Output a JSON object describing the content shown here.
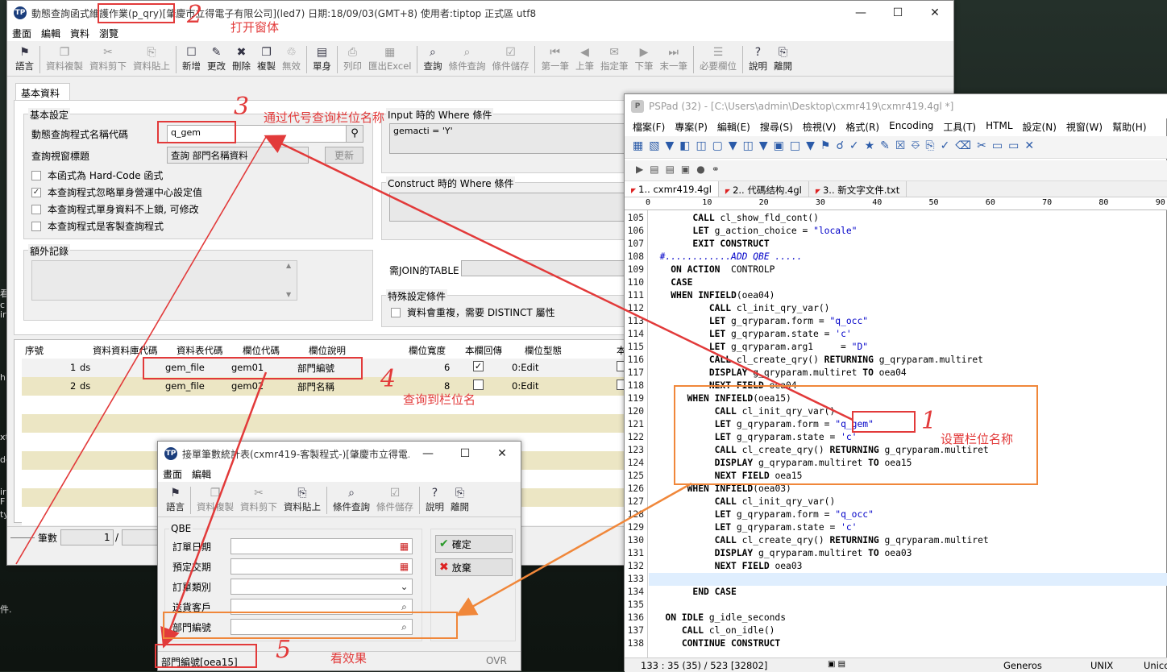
{
  "desktop_fragments": [
    "看",
    "c",
    "ir",
    "h",
    "xt",
    "dc",
    "ir",
    "F",
    "ty",
    "件."
  ],
  "main_window": {
    "title": "動態查詢函式維護作業(p_qry)[肇慶市立得電子有限公司](led7)  日期:18/09/03(GMT+8)  使用者:tiptop 正式區 utf8",
    "menu": [
      "畫面",
      "編輯",
      "資料",
      "瀏覽"
    ],
    "toolbar": [
      {
        "label": "語言",
        "icon": "flag-icon",
        "enabled": true
      },
      {
        "label": "資料複製",
        "icon": "copy-icon",
        "enabled": false
      },
      {
        "label": "資料剪下",
        "icon": "scissors-icon",
        "enabled": false
      },
      {
        "label": "資料貼上",
        "icon": "paste-icon",
        "enabled": false
      },
      {
        "label": "新增",
        "icon": "new-doc-icon",
        "enabled": true
      },
      {
        "label": "更改",
        "icon": "pencil-icon",
        "enabled": true
      },
      {
        "label": "刪除",
        "icon": "delete-icon",
        "enabled": true
      },
      {
        "label": "複製",
        "icon": "duplicate-icon",
        "enabled": true
      },
      {
        "label": "無效",
        "icon": "trash-icon",
        "enabled": false
      },
      {
        "label": "單身",
        "icon": "detail-icon",
        "enabled": true
      },
      {
        "label": "列印",
        "icon": "printer-icon",
        "enabled": false
      },
      {
        "label": "匯出Excel",
        "icon": "excel-icon",
        "enabled": false
      },
      {
        "label": "查詢",
        "icon": "query-icon",
        "enabled": true
      },
      {
        "label": "條件查詢",
        "icon": "condition-query-icon",
        "enabled": false
      },
      {
        "label": "條件儲存",
        "icon": "condition-save-icon",
        "enabled": false
      },
      {
        "label": "第一筆",
        "icon": "first-record-icon",
        "enabled": false
      },
      {
        "label": "上筆",
        "icon": "prev-record-icon",
        "enabled": false
      },
      {
        "label": "指定筆",
        "icon": "goto-record-icon",
        "enabled": false
      },
      {
        "label": "下筆",
        "icon": "next-record-icon",
        "enabled": false
      },
      {
        "label": "末一筆",
        "icon": "last-record-icon",
        "enabled": false
      },
      {
        "label": "必要欄位",
        "icon": "required-fields-icon",
        "enabled": false
      },
      {
        "label": "說明",
        "icon": "help-icon",
        "enabled": true
      },
      {
        "label": "離開",
        "icon": "exit-icon",
        "enabled": true
      }
    ],
    "tab": "基本資料",
    "basic_group": "基本設定",
    "func_code_label": "動態查詢程式名稱代碼",
    "func_code_value": "q_gem",
    "title_label": "查詢視窗標題",
    "title_value": "查詢 部門名稱資料",
    "update_button": "更新",
    "checkboxes": [
      {
        "label": "本函式為 Hard-Code 函式",
        "checked": false
      },
      {
        "label": "本查詢程式忽略單身營運中心設定值",
        "checked": true
      },
      {
        "label": "本查詢程式單身資料不上鎖, 可修改",
        "checked": false
      },
      {
        "label": "本查詢程式是客製查詢程式",
        "checked": false
      }
    ],
    "extra_group": "額外記錄",
    "input_where_label": "Input 時的 Where 條件",
    "input_where_value": "gemacti = 'Y'",
    "construct_where_label": "Construct 時的 Where 條件",
    "join_label": "需JOIN的TABLE",
    "special_group": "特殊設定條件",
    "distinct_label": "資料會重複，需要 DISTINCT 屬性",
    "grid_headers": [
      "序號",
      "資料資料庫代碼",
      "資料表代碼",
      "欄位代碼",
      "欄位說明",
      "欄位寬度",
      "本欄回傳",
      "欄位型態",
      "本欄"
    ],
    "grid_rows": [
      {
        "seq": "1",
        "db": "ds",
        "table": "gem_file",
        "field": "gem01",
        "desc": "部門編號",
        "width": "6",
        "ret": true,
        "type": "0:Edit"
      },
      {
        "seq": "2",
        "db": "ds",
        "table": "gem_file",
        "field": "gem02",
        "desc": "部門名稱",
        "width": "8",
        "ret": false,
        "type": "0:Edit"
      }
    ],
    "status_count_label": "筆數",
    "status_count": "1",
    "status_slash": "/"
  },
  "pspad": {
    "title": "PSPad (32) - [C:\\Users\\admin\\Desktop\\cxmr419\\cxmr419.4gl *]",
    "menu": [
      "檔案(F)",
      "專案(P)",
      "編輯(E)",
      "搜尋(S)",
      "檢視(V)",
      "格式(R)",
      "Encoding",
      "工具(T)",
      "HTML",
      "設定(N)",
      "視窗(W)",
      "幫助(H)"
    ],
    "tabs": [
      "1.. cxmr419.4gl",
      "2.. 代碼结构.4gl",
      "3.. 新文字文件.txt"
    ],
    "ruler": [
      "0",
      "10",
      "20",
      "30",
      "40",
      "50",
      "60",
      "70",
      "80",
      "90"
    ],
    "lines": [
      {
        "n": "105",
        "html": "        <span class='kw'>CALL</span> cl_show_fld_cont()"
      },
      {
        "n": "106",
        "html": "        <span class='kw'>LET</span> g_action_choice = <span class='str'>\"locale\"</span>"
      },
      {
        "n": "107",
        "html": "        <span class='kw'>EXIT CONSTRUCT</span>"
      },
      {
        "n": "108",
        "html": "  <span class='cmt'>#............ADD QBE .....</span>"
      },
      {
        "n": "109",
        "html": "    <span class='kw'>ON ACTION</span>  CONTROLP"
      },
      {
        "n": "110",
        "html": "    <span class='kw'>CASE</span>"
      },
      {
        "n": "111",
        "html": "    <span class='kw'>WHEN INFIELD</span>(oea04)"
      },
      {
        "n": "112",
        "html": "           <span class='kw'>CALL</span> cl_init_qry_var()"
      },
      {
        "n": "113",
        "html": "           <span class='kw'>LET</span> g_qryparam.form = <span class='str'>\"q_occ\"</span>"
      },
      {
        "n": "114",
        "html": "           <span class='kw'>LET</span> g_qryparam.state = <span class='str'>'c'</span>"
      },
      {
        "n": "115",
        "html": "           <span class='kw'>LET</span> g_qryparam.arg1     = <span class='str'>\"D\"</span>"
      },
      {
        "n": "116",
        "html": "           <span class='kw'>CALL</span> cl_create_qry() <span class='kw'>RETURNING</span> g_qryparam.multiret"
      },
      {
        "n": "117",
        "html": "           <span class='kw'>DISPLAY</span> g_qryparam.multiret <span class='kw'>TO</span> oea04"
      },
      {
        "n": "118",
        "html": "           <span class='kw'>NEXT FIELD</span> oea04"
      },
      {
        "n": "119",
        "html": "       <span class='kw'>WHEN INFIELD</span>(oea15)"
      },
      {
        "n": "120",
        "html": "            <span class='kw'>CALL</span> cl_init_qry_var()"
      },
      {
        "n": "121",
        "html": "            <span class='kw'>LET</span> g_qryparam.form = <span class='str'>\"q_gem\"</span>"
      },
      {
        "n": "122",
        "html": "            <span class='kw'>LET</span> g_qryparam.state = <span class='str'>'c'</span>"
      },
      {
        "n": "123",
        "html": "            <span class='kw'>CALL</span> cl_create_qry() <span class='kw'>RETURNING</span> g_qryparam.multiret"
      },
      {
        "n": "124",
        "html": "            <span class='kw'>DISPLAY</span> g_qryparam.multiret <span class='kw'>TO</span> oea15"
      },
      {
        "n": "125",
        "html": "            <span class='kw'>NEXT FIELD</span> oea15"
      },
      {
        "n": "126",
        "html": "       <span class='kw'>WHEN INFIELD</span>(oea03)"
      },
      {
        "n": "127",
        "html": "            <span class='kw'>CALL</span> cl_init_qry_var()"
      },
      {
        "n": "128",
        "html": "            <span class='kw'>LET</span> g_qryparam.form = <span class='str'>\"q_occ\"</span>"
      },
      {
        "n": "129",
        "html": "            <span class='kw'>LET</span> g_qryparam.state = <span class='str'>'c'</span>"
      },
      {
        "n": "130",
        "html": "            <span class='kw'>CALL</span> cl_create_qry() <span class='kw'>RETURNING</span> g_qryparam.multiret"
      },
      {
        "n": "131",
        "html": "            <span class='kw'>DISPLAY</span> g_qryparam.multiret <span class='kw'>TO</span> oea03"
      },
      {
        "n": "132",
        "html": "            <span class='kw'>NEXT FIELD</span> oea03"
      },
      {
        "n": "133",
        "html": ""
      },
      {
        "n": "134",
        "html": "        <span class='kw'>END CASE</span>"
      },
      {
        "n": "135",
        "html": ""
      },
      {
        "n": "136",
        "html": "   <span class='kw'>ON IDLE</span> g_idle_seconds"
      },
      {
        "n": "137",
        "html": "      <span class='kw'>CALL</span> cl_on_idle()"
      },
      {
        "n": "138",
        "html": "      <span class='kw'>CONTINUE CONSTRUCT</span>"
      }
    ],
    "status": [
      "133 : 35 (35) / 523  [32802]",
      "Generos",
      "UNIX",
      "Unicode"
    ]
  },
  "query_window": {
    "title": "接單筆數統計表(cxmr419-客製程式-)[肇慶市立得電...",
    "menu": [
      "畫面",
      "編輯"
    ],
    "toolbar": [
      {
        "label": "語言",
        "icon": "flag-icon",
        "enabled": true
      },
      {
        "label": "資料複製",
        "icon": "copy-icon",
        "enabled": false
      },
      {
        "label": "資料剪下",
        "icon": "scissors-icon",
        "enabled": false
      },
      {
        "label": "資料貼上",
        "icon": "paste-icon",
        "enabled": true
      },
      {
        "label": "條件查詢",
        "icon": "condition-query-icon",
        "enabled": true
      },
      {
        "label": "條件儲存",
        "icon": "condition-save-icon",
        "enabled": false
      },
      {
        "label": "說明",
        "icon": "help-icon",
        "enabled": true
      },
      {
        "label": "離開",
        "icon": "exit-icon",
        "enabled": true
      }
    ],
    "qbe_label": "QBE",
    "fields": [
      "訂單日期",
      "預定交期",
      "訂單類別",
      "送貨客戶",
      "部門編號"
    ],
    "ok": "確定",
    "cancel": "放棄",
    "status_field": "部門編號[oea15]",
    "status_mode": "OVR"
  },
  "annotations": {
    "n1": "1",
    "n2": "2",
    "n3": "3",
    "n4": "4",
    "n5": "5",
    "t2": "打开窗体",
    "t3": "通过代号查询栏位名称",
    "t4": "查询到栏位名",
    "t1": "设置栏位名称",
    "t5": "看效果"
  },
  "colors": {
    "annotation_red": "#e23a3a",
    "annotation_orange": "#f0873a",
    "row_highlight": "#ece6c4",
    "selected_row": "#f2f2f2"
  }
}
